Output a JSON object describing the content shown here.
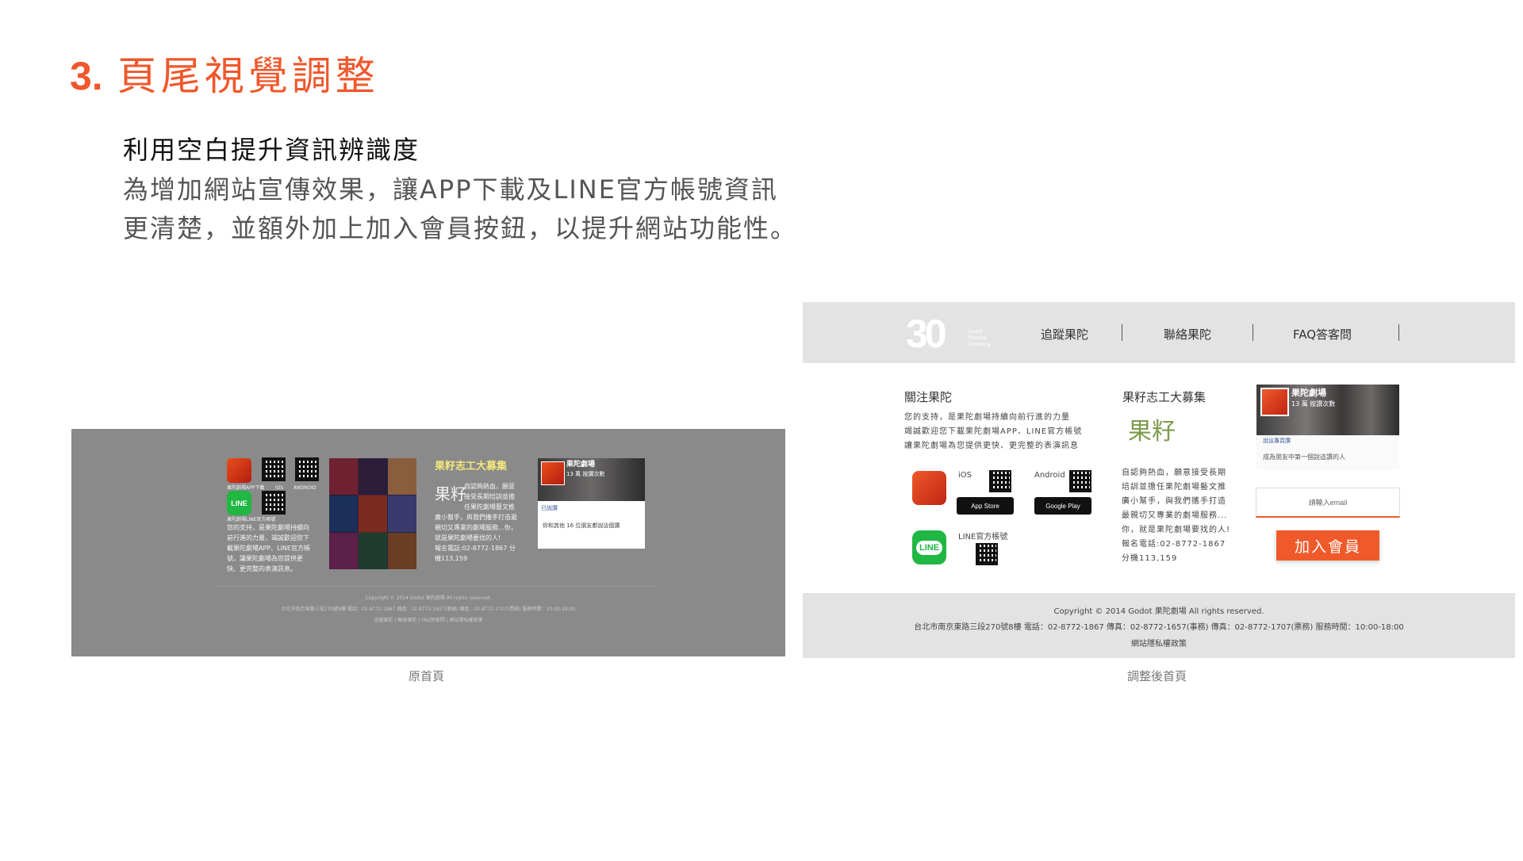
{
  "heading": {
    "number": "3.",
    "title": "頁尾視覺調整"
  },
  "subtitle": "利用空白提升資訊辨識度",
  "description": [
    "為增加網站宣傳效果，讓APP下載及LINE官方帳號資訊",
    "更清楚，並額外加上加入會員按鈕，以提升網站功能性。"
  ],
  "captions": {
    "old": "原首頁",
    "new": "調整後首頁"
  },
  "old_footer": {
    "app_label": "果陀劇場APP下載",
    "ios": "iOS",
    "android": "ANDROID",
    "line_icon": "LINE",
    "line_label": "果陀劇場LINE官方帳號",
    "support_text": [
      "您的支持，是果陀劇場持續向",
      "前行進的力量，竭誠歡迎您下",
      "載果陀劇場APP、LINE官方帳",
      "號，讓果陀劇場為您提供更",
      "快、更完整的表演訊息。"
    ],
    "volunteer_title": "果籽志工大募集",
    "volunteer_logo": "果籽",
    "volunteer_text": [
      "自認夠熱血，願意",
      "接受長期培訓並擔",
      "任果陀劇場藝文推",
      "廣小幫手，與我們攜手打造最",
      "親切又專業的劇場服務...你，",
      "就是果陀劇場要找的人!",
      "報名電話:02-8772-1867 分",
      "機113,159"
    ],
    "fb_name": "果陀劇場",
    "fb_likes": "13 萬 按讚次數",
    "fb_liked": "已說讚",
    "fb_friends": "你和其他 16 位朋友都說這個讚",
    "copyright": "Copyright © 2014 Godot 果陀劇場 All rights reserved.",
    "address": "台北市南京東路三段270號8樓 電話：02-8772-1867 傳真：02-8772-1657(事務) 傳真：02-8772-1707(票務) 服務時間：10:00-18:00",
    "links": "追蹤果陀 | 聯絡果陀 | FAQ答客問 | 網站隱私權政策"
  },
  "new_footer": {
    "logo_text": "30",
    "logo_sub": [
      "Godot",
      "Theatre",
      "Company"
    ],
    "nav": [
      "追蹤果陀",
      "聯絡果陀",
      "FAQ答客問"
    ],
    "follow_title": "關注果陀",
    "follow_text": [
      "您的支持，是果陀劇場持續向前行進的力量",
      "竭誠歡迎您下載果陀劇場APP、LINE官方帳號",
      "讓果陀劇場為您提供更快、更完整的表演訊息"
    ],
    "ios": "iOS",
    "android": "Android",
    "app_store": "App Store",
    "google_play": "Google Play",
    "line_icon": "LINE",
    "line_label": "LINE官方帳號",
    "volunteer_title": "果籽志工大募集",
    "volunteer_logo": "果籽",
    "volunteer_text": [
      "自認夠熱血，願意接受長期",
      "培訓並擔任果陀劇場藝文推",
      "廣小幫手，與我們攜手打造",
      "最親切又專業的劇場服務...",
      "你，就是果陀劇場要找的人!",
      "報名電話:02-8772-1867",
      "分機113,159"
    ],
    "fb_name": "果陀劇場",
    "fb_likes": "13 萬 按讚次數",
    "fb_bar": "說這專頁讚",
    "fb_msg": "成為朋友中第一個說這讚的人",
    "email_placeholder": "請輸入email",
    "join_button": "加入會員",
    "copyright": "Copyright © 2014 Godot 果陀劇場 All rights reserved.",
    "address": "台北市南京東路三段270號8樓 電話：02-8772-1867 傳真：02-8772-1657(事務) 傳真：02-8772-1707(票務) 服務時間：10:00-18:00",
    "privacy": "網站隱私權政策"
  },
  "colors": {
    "accent": "#f0572b",
    "line_green": "#20b743",
    "old_bg": "#8a8a8a",
    "new_band": "#e3e3e3"
  }
}
